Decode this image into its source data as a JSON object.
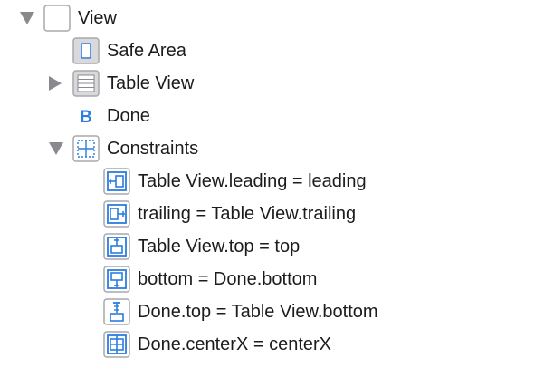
{
  "tree": {
    "view": {
      "label": "View",
      "icon": "view-icon",
      "expanded": true
    },
    "safe_area": {
      "label": "Safe Area",
      "icon": "safe-area-icon"
    },
    "table_view": {
      "label": "Table View",
      "icon": "table-view-icon",
      "expanded": false
    },
    "done": {
      "label": "Done",
      "icon": "button-icon",
      "icon_glyph": "B"
    },
    "constraints": {
      "label": "Constraints",
      "icon": "constraints-icon",
      "expanded": true
    },
    "constraint_items": [
      {
        "label": "Table View.leading = leading",
        "icon": "leading-constraint-icon"
      },
      {
        "label": "trailing = Table View.trailing",
        "icon": "trailing-constraint-icon"
      },
      {
        "label": "Table View.top = top",
        "icon": "top-constraint-icon"
      },
      {
        "label": "bottom = Done.bottom",
        "icon": "bottom-constraint-icon"
      },
      {
        "label": "Done.top = Table View.bottom",
        "icon": "vertical-spacing-constraint-icon"
      },
      {
        "label": "Done.centerX = centerX",
        "icon": "center-x-constraint-icon"
      }
    ]
  },
  "colors": {
    "accent": "#2b7de0",
    "disclosure": "#8a8a8e",
    "icon_border": "#a9a9ad",
    "icon_fill": "#ffffff",
    "text": "#1c1c1e"
  }
}
